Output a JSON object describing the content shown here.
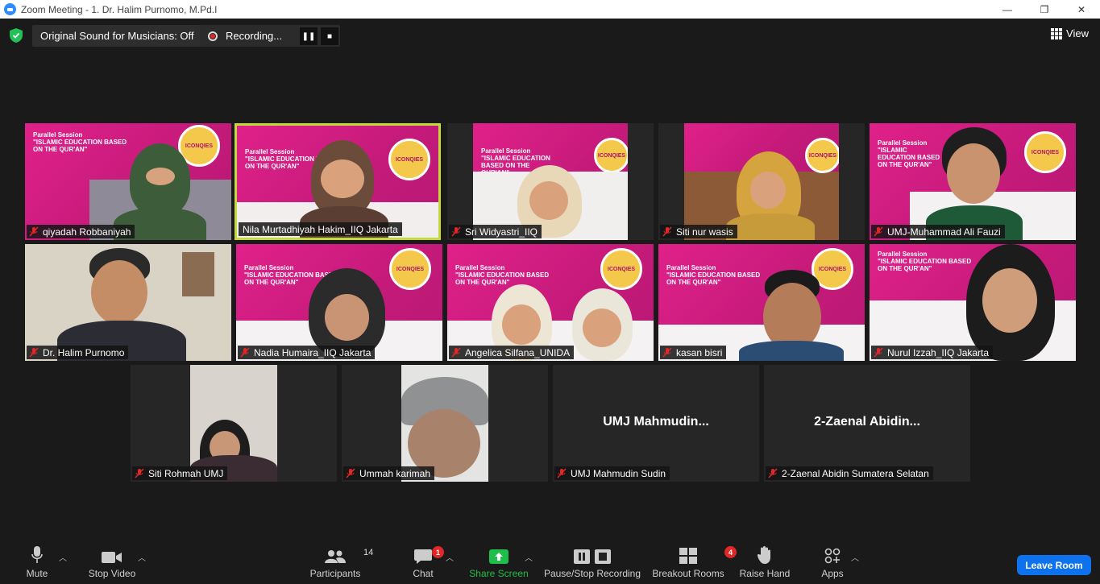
{
  "window": {
    "title": "Zoom Meeting - 1. Dr. Halim Purnomo, M.Pd.I",
    "minimize": "—",
    "restore": "❐",
    "close": "✕"
  },
  "topbar": {
    "original_sound": "Original Sound for Musicians: Off",
    "recording": "Recording...",
    "pause_icon": "❚❚",
    "stop_icon": "■",
    "view": "View"
  },
  "participants": [
    {
      "name": "qiyadah Robbaniyah"
    },
    {
      "name": "Nila Murtadhiyah Hakim_IIQ Jakarta"
    },
    {
      "name": "Sri Widyastri_IIQ"
    },
    {
      "name": "Siti nur wasis"
    },
    {
      "name": "UMJ-Muhammad Ali Fauzi"
    },
    {
      "name": "Dr. Halim Purnomo"
    },
    {
      "name": "Nadia Humaira_IIQ Jakarta"
    },
    {
      "name": "Angelica Silfana_UNIDA"
    },
    {
      "name": "kasan bisri"
    },
    {
      "name": "Nurul Izzah_IIQ Jakarta"
    },
    {
      "name": "Siti Rohmah UMJ"
    },
    {
      "name": "Ummah karimah"
    },
    {
      "name": "UMJ Mahmudin Sudin",
      "display": "UMJ  Mahmudin..."
    },
    {
      "name": "2-Zaenal Abidin Sumatera Selatan",
      "display": "2-Zaenal  Abidin..."
    }
  ],
  "banner": {
    "line1": "Parallel Session",
    "line2": "\"ISLAMIC EDUCATION BASED ON THE QUR'AN\"",
    "logo": "ICONQIES"
  },
  "toolbar": {
    "mute": "Mute",
    "stop_video": "Stop Video",
    "participants": "Participants",
    "participants_count": "14",
    "chat": "Chat",
    "chat_badge": "1",
    "share_screen": "Share Screen",
    "pause_stop_recording": "Pause/Stop Recording",
    "breakout_rooms": "Breakout Rooms",
    "breakout_badge": "4",
    "raise_hand": "Raise Hand",
    "apps": "Apps",
    "leave_room": "Leave Room"
  },
  "colors": {
    "banner_pink": "#d81f84",
    "active_speaker": "#c6d93b",
    "share_green": "#1fbd4a",
    "leave_blue": "#0e72ed",
    "muted_red": "#e02828"
  }
}
